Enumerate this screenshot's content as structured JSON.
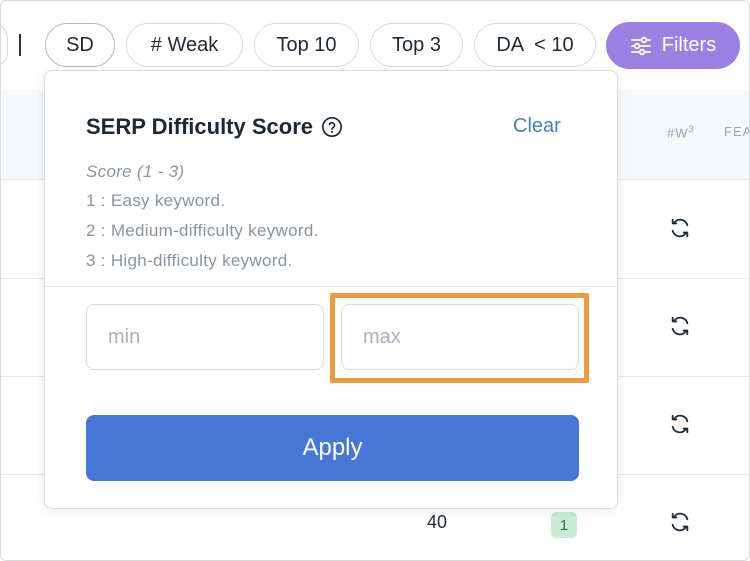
{
  "chips": {
    "sd": "SD",
    "weak": "# Weak",
    "top10": "Top 10",
    "top3": "Top 3",
    "da": "DA  < 10"
  },
  "filters_button": {
    "label": "Filters",
    "color": "#9b7fe3",
    "icon": "sliders-icon"
  },
  "table": {
    "columns": {
      "w3": "#W",
      "w3_sup": "3",
      "fea": "FEA"
    },
    "row4": {
      "value": "40",
      "badge": "1"
    },
    "row_icon": "refresh-icon"
  },
  "popover": {
    "title": "SERP Difficulty Score",
    "help_icon": "question-circle-icon",
    "clear": "Clear",
    "score_range": "Score (1 - 3)",
    "levels": [
      "1 : Easy keyword.",
      "2 : Medium-difficulty keyword.",
      "3 : High-difficulty keyword."
    ],
    "min_placeholder": "min",
    "max_placeholder": "max",
    "apply": "Apply",
    "apply_color": "#4677d6",
    "highlight_color": "#ec9a3c"
  }
}
